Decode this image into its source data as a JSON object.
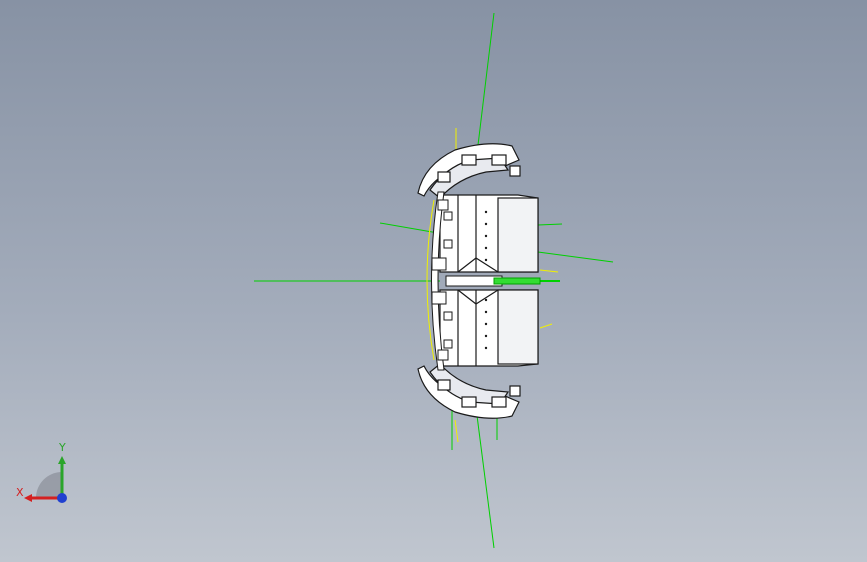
{
  "viewport": {
    "background_top": "#8792a4",
    "background_bottom": "#c0c6cf"
  },
  "model": {
    "edge_color": "#1a1a1a",
    "face_color": "#ffffff",
    "sketch_color": "#00d000",
    "highlight_color": "#f0f000"
  },
  "triad": {
    "x_label": "X",
    "y_label": "Y",
    "x_color": "#d42020",
    "y_color": "#2aa52a",
    "z_color": "#2040d0"
  }
}
